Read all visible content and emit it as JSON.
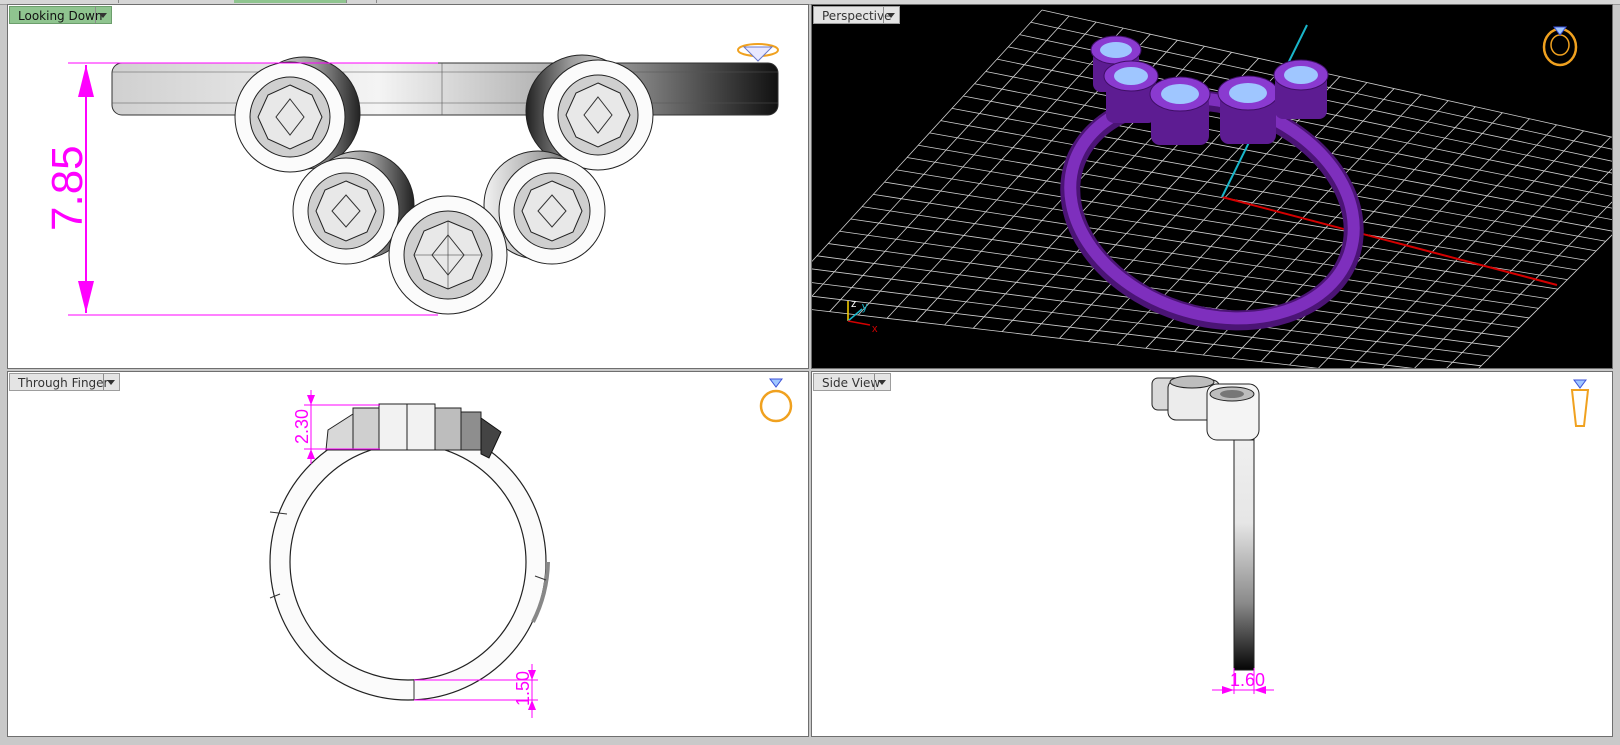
{
  "viewports": {
    "top_left": {
      "label": "Looking Down",
      "dimension": "7.85"
    },
    "top_right": {
      "label": "Perspective",
      "axis_z": "z",
      "axis_y": "y",
      "axis_x": "x"
    },
    "bottom_left": {
      "label": "Through Finger",
      "dimension_top": "2.30",
      "dimension_bottom": "1.50"
    },
    "bottom_right": {
      "label": "Side View",
      "dimension": "1.60"
    }
  },
  "icons": {
    "top_left": "diamond-icon",
    "top_right": "ring-with-gem-icon",
    "bottom_left": "ring-front-icon",
    "bottom_right": "ring-side-icon"
  },
  "colors": {
    "active_viewport_label": "#8fc48f",
    "dimension": "#ff00ff",
    "ring_metal": "#6a1f9a",
    "gem": "#8ab8ff",
    "grid": "#cfcfcf",
    "x_axis": "#d40000",
    "y_axis": "#19b5c9",
    "icon": "#f0a11f"
  }
}
